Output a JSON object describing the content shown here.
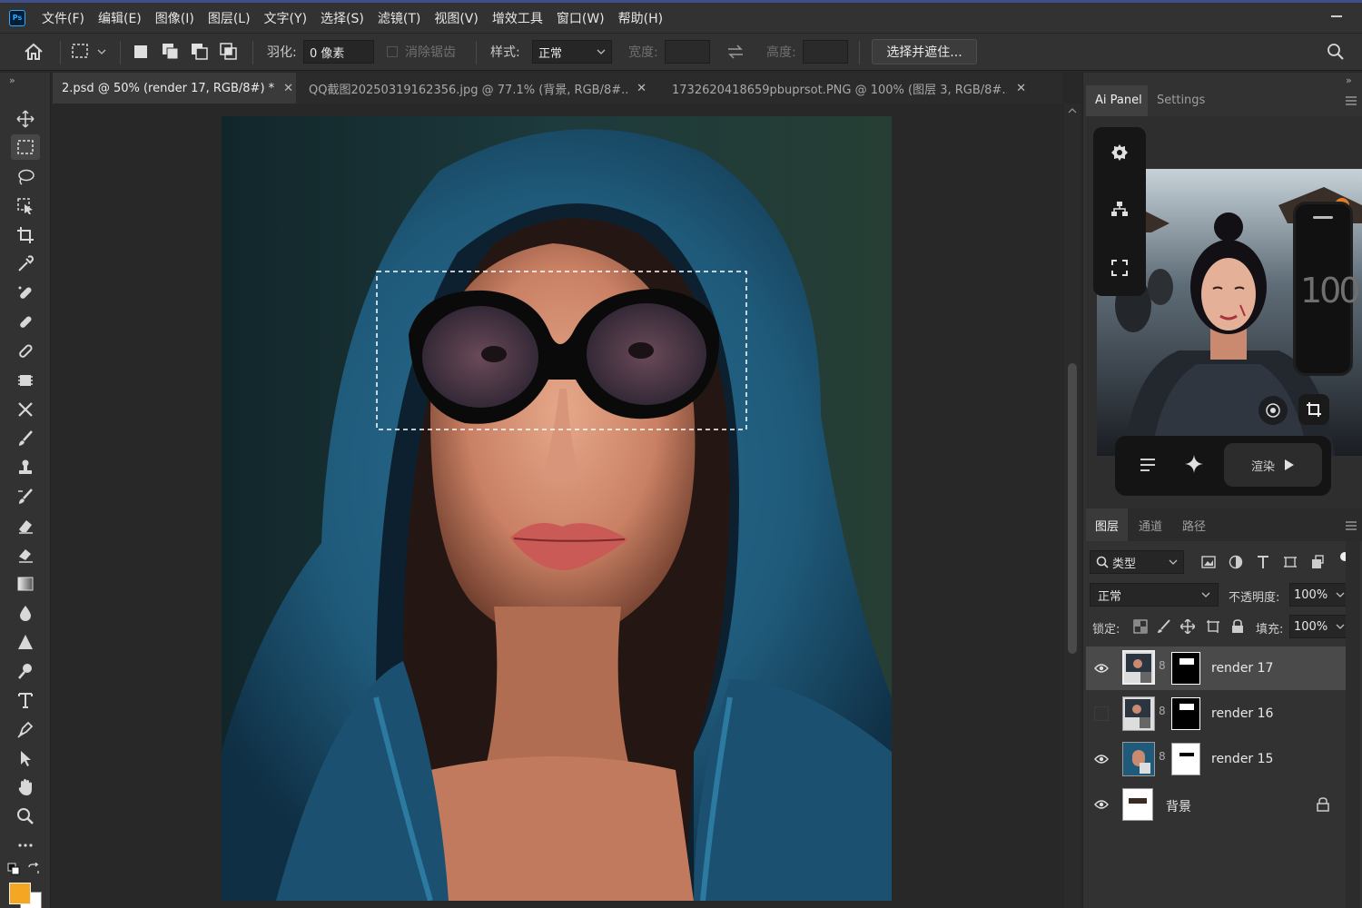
{
  "menubar": {
    "app_icon": "ps-app-icon",
    "app_icon_text": "Ps",
    "items": [
      "文件(F)",
      "编辑(E)",
      "图像(I)",
      "图层(L)",
      "文字(Y)",
      "选择(S)",
      "滤镜(T)",
      "视图(V)",
      "增效工具",
      "窗口(W)",
      "帮助(H)"
    ]
  },
  "options": {
    "feather_label": "羽化:",
    "feather_value": "0 像素",
    "antialias_label": "消除锯齿",
    "style_label": "样式:",
    "style_value": "正常",
    "width_label": "宽度:",
    "height_label": "高度:",
    "select_mask_button": "选择并遮住..."
  },
  "tabs": [
    {
      "label": "2.psd @ 50% (render 17, RGB/8#) *",
      "active": true
    },
    {
      "label": "QQ截图20250319162356.jpg @ 77.1% (背景, RGB/8#...",
      "active": false
    },
    {
      "label": "1732620418659pbuprsot.PNG @ 100% (图层 3, RGB/8#...",
      "active": false
    }
  ],
  "ai_panel": {
    "tab_ai": "Ai Panel",
    "tab_settings": "Settings",
    "value_display": "100",
    "render_button": "渲染"
  },
  "layers_panel": {
    "tabs": [
      "图层",
      "通道",
      "路径"
    ],
    "filter_label": "类型",
    "blend_mode": "正常",
    "opacity_label": "不透明度:",
    "opacity_value": "100%",
    "lock_label": "锁定:",
    "fill_label": "填充:",
    "fill_value": "100%",
    "layers": [
      {
        "name": "render 17",
        "visible": true,
        "selected": true
      },
      {
        "name": "render 16",
        "visible": false,
        "selected": false
      },
      {
        "name": "render 15",
        "visible": true,
        "selected": false
      },
      {
        "name": "背景",
        "visible": true,
        "selected": false,
        "locked": true
      }
    ]
  },
  "colors": {
    "foreground": "#f5a623",
    "background": "#ffffff",
    "hood": "#1f5a7a",
    "accent": "#31a8ff"
  }
}
